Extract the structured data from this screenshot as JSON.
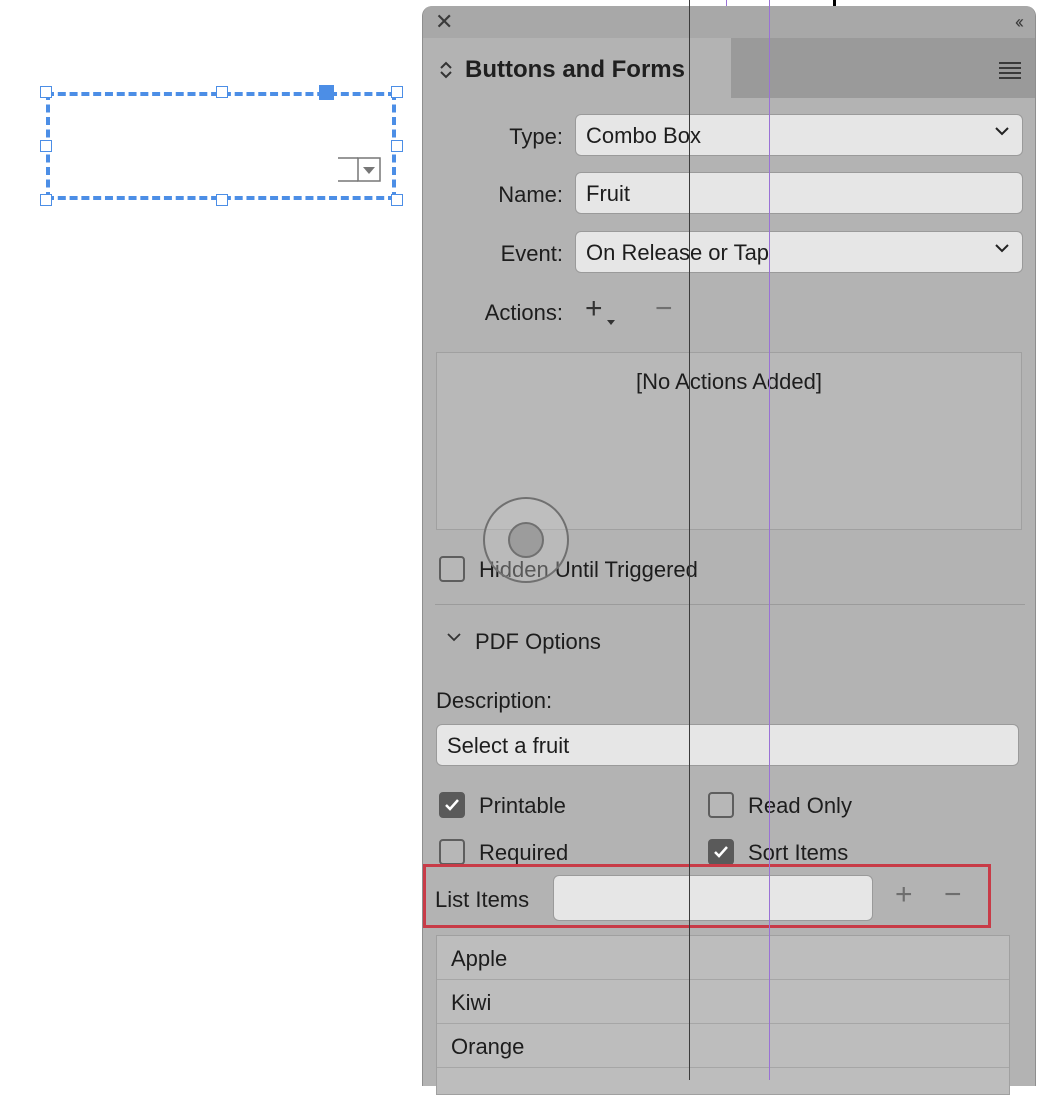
{
  "panel": {
    "title": "Buttons and Forms",
    "close_glyph": "✕",
    "collapse_glyph": "‹‹"
  },
  "form": {
    "type_label": "Type:",
    "type_value": "Combo Box",
    "name_label": "Name:",
    "name_value": "Fruit",
    "event_label": "Event:",
    "event_value": "On Release or Tap",
    "actions_label": "Actions:",
    "add_glyph": "+",
    "remove_glyph": "−",
    "actions_empty": "[No Actions Added]",
    "hidden_label": "Hidden Until Triggered",
    "hidden_checked": false
  },
  "pdf_options": {
    "section_label": "PDF Options",
    "description_label": "Description:",
    "description_value": "Select a fruit",
    "printable_label": "Printable",
    "printable_checked": true,
    "read_only_label": "Read Only",
    "read_only_checked": false,
    "required_label": "Required",
    "required_checked": false,
    "sort_items_label": "Sort Items",
    "sort_items_checked": true,
    "list_items_label": "List Items",
    "list_items_input": "",
    "list_items": [
      "Apple",
      "Kiwi",
      "Orange"
    ]
  },
  "colors": {
    "selection_blue": "#4c8ee6",
    "highlight_red": "#c83b47",
    "guide_purple": "#9a72d6"
  }
}
